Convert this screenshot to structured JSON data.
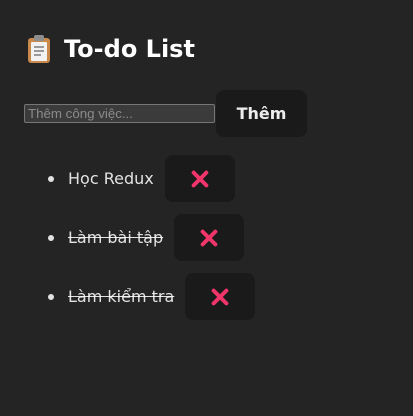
{
  "app": {
    "title": "To-do List",
    "title_icon": "clipboard-icon",
    "accent_delete_color": "#f0356a",
    "background_color": "#242424"
  },
  "add_form": {
    "input_value": "",
    "input_placeholder": "Thêm công việc...",
    "add_button_label": "Thêm"
  },
  "todos": [
    {
      "text": "Học Redux",
      "completed": false,
      "delete_icon": "close-icon"
    },
    {
      "text": "Làm bài tập",
      "completed": true,
      "delete_icon": "close-icon"
    },
    {
      "text": "Làm kiểm tra",
      "completed": true,
      "delete_icon": "close-icon"
    }
  ]
}
